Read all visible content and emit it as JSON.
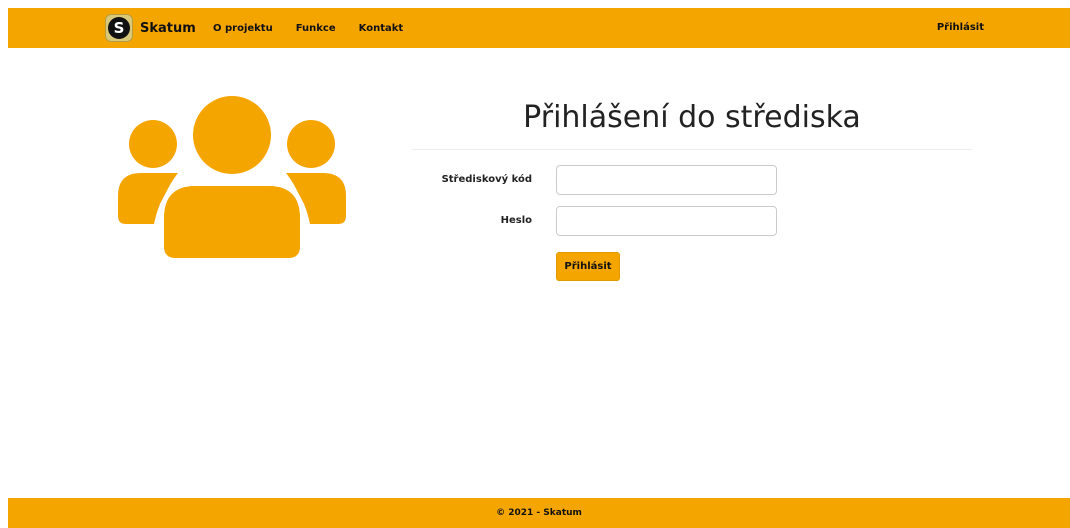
{
  "navbar": {
    "brand_logo_letter": "S",
    "brand_name": "Skatum",
    "links": [
      "O projektu",
      "Funkce",
      "Kontakt"
    ],
    "login_label": "Přihlásit"
  },
  "illustration": {
    "icon": "users-group-icon",
    "color": "#f5a500"
  },
  "form": {
    "title": "Přihlášení do střediska",
    "fields": [
      {
        "label": "Střediskový kód",
        "value": "",
        "type": "text"
      },
      {
        "label": "Heslo",
        "value": "",
        "type": "password"
      }
    ],
    "submit_label": "Přihlásit"
  },
  "footer": {
    "text": "© 2021 - Skatum"
  },
  "colors": {
    "accent": "#f5a500",
    "text": "#111111",
    "background": "#ffffff"
  }
}
